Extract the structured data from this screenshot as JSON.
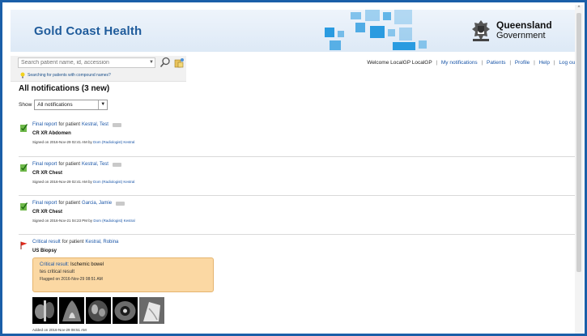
{
  "header": {
    "brand": "Gold Coast Health",
    "gov_title": "Queensland",
    "gov_subtitle": "Government",
    "accent_color": "#2a9be0"
  },
  "search": {
    "placeholder": "Search patient name, id, accession",
    "hint": "Searching for patients with compound names?"
  },
  "topnav": {
    "welcome": "Welcome LocalGP LocalGP",
    "links": [
      "My notifications",
      "Patients",
      "Profile",
      "Help",
      "Log out"
    ]
  },
  "page": {
    "title": "All notifications (3 new)",
    "filter_label": "Show",
    "filter_value": "All notifications"
  },
  "notifications": [
    {
      "type": "final",
      "icon": "green-check-icon",
      "kind_label": "Final report",
      "for_text": "for patient",
      "patient": "Kestral, Test",
      "study": "CR XR Abdomen",
      "signed_prefix": "Signed on 2016-Nov-29 02:41 AM by",
      "signer": "Dom (Radiologist) Kestral"
    },
    {
      "type": "final",
      "icon": "green-check-icon",
      "kind_label": "Final report",
      "for_text": "for patient",
      "patient": "Kestral, Test",
      "study": "CR XR Chest",
      "signed_prefix": "Signed on 2016-Nov-29 02:41 AM by",
      "signer": "Dom (Radiologist) Kestral"
    },
    {
      "type": "final",
      "icon": "green-check-icon",
      "kind_label": "Final report",
      "for_text": "for patient",
      "patient": "Garcia, Jamie",
      "study": "CR XR Chest",
      "signed_prefix": "Signed on 2016-Nov-21 04:23 PM by",
      "signer": "Dom (Radiologist) Kestral"
    },
    {
      "type": "critical",
      "icon": "red-flag-icon",
      "kind_label": "Critical result",
      "for_text": "for patient",
      "patient": "Kestral, Robina",
      "study": "US Biopsy",
      "critical_label": "Critical result:",
      "critical_value": "Ischemic bowel",
      "critical_note": "tes critical result",
      "flagged": "Flagged on 2016-Nov-29 08:51 AM",
      "added": "Added on 2016-Nov-29 08:51 AM"
    }
  ]
}
